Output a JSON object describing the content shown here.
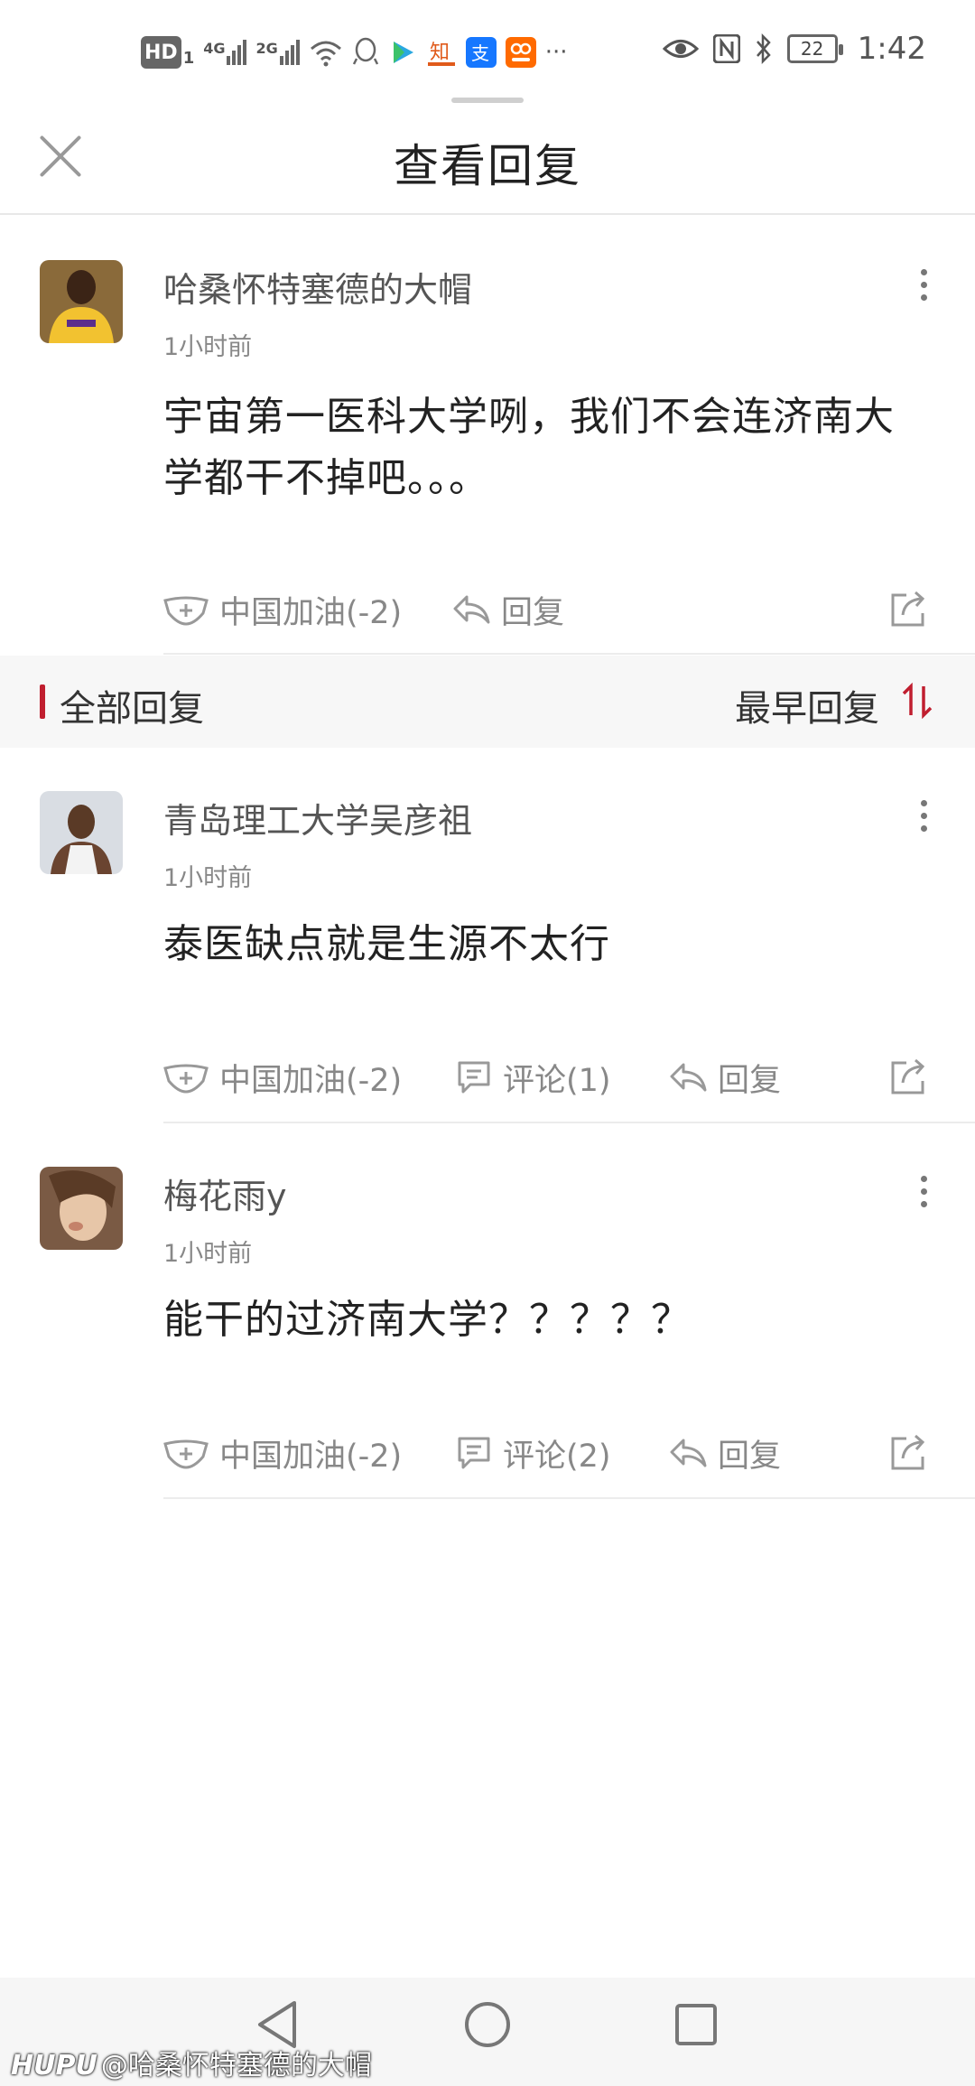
{
  "status_bar": {
    "hd_label": "HD",
    "sim1": "1",
    "net1": "4G",
    "net2": "2G",
    "more": "···",
    "battery": "22",
    "time": "1:42",
    "icons": [
      "signal-icon",
      "wifi-icon",
      "qq-icon",
      "video-app-icon",
      "zhihu-icon",
      "alipay-icon",
      "taobao-icon",
      "eye-icon",
      "nfc-icon",
      "bluetooth-icon",
      "battery-icon"
    ]
  },
  "header": {
    "title": "查看回复"
  },
  "original": {
    "username": "哈桑怀特塞德的大帽",
    "time": "1小时前",
    "text": "宇宙第一医科大学咧，我们不会连济南大学都干不掉吧。。。",
    "like_label": "中国加油(-2)",
    "reply_label": "回复"
  },
  "section": {
    "title": "全部回复",
    "sort_label": "最早回复"
  },
  "replies": [
    {
      "username": "青岛理工大学吴彦祖",
      "time": "1小时前",
      "text": "泰医缺点就是生源不太行",
      "like_label": "中国加油(-2)",
      "comment_label": "评论(1)",
      "reply_label": "回复"
    },
    {
      "username": "梅花雨y",
      "time": "1小时前",
      "text": "能干的过济南大学？？？？？",
      "like_label": "中国加油(-2)",
      "comment_label": "评论(2)",
      "reply_label": "回复"
    }
  ],
  "watermark": {
    "brand": "HUPU",
    "handle": "@哈桑怀特塞德的大帽"
  },
  "colors": {
    "accent": "#c01e2f",
    "text_primary": "#222222",
    "text_secondary": "#888888"
  }
}
